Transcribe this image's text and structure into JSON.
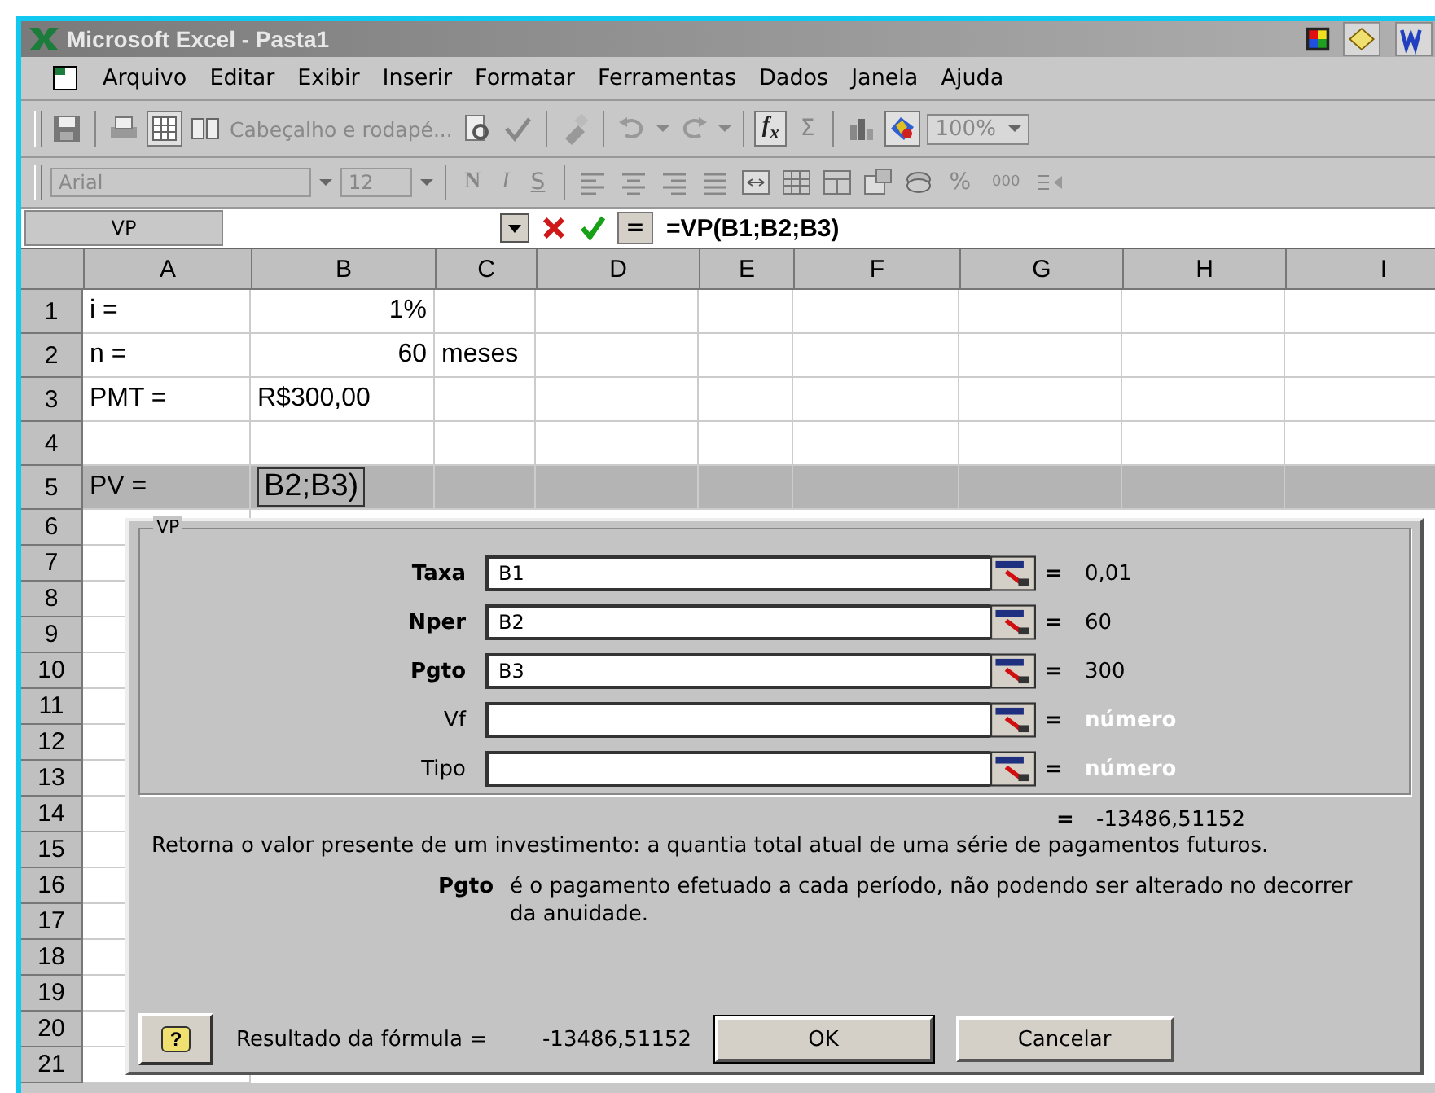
{
  "window": {
    "title": "Microsoft Excel - Pasta1"
  },
  "menu": [
    "Arquivo",
    "Editar",
    "Exibir",
    "Inserir",
    "Formatar",
    "Ferramentas",
    "Dados",
    "Janela",
    "Ajuda"
  ],
  "standard_toolbar": {
    "disabled": true,
    "header_footer": "Cabeçalho e rodapé...",
    "function": "f$_{x}$",
    "autosum": "Σ",
    "zoom": "100%"
  },
  "formatting_toolbar": {
    "disabled": true,
    "font": "Arial",
    "size": "12",
    "bold": "N",
    "italic": "I",
    "underline": "S",
    "percent": "%",
    "thousands": "000"
  },
  "formula_bar": {
    "name_box": "VP",
    "equals": "=",
    "formula": "=VP(B1;B2;B3)"
  },
  "sheet": {
    "columns": [
      "A",
      "B",
      "C",
      "D",
      "E",
      "F",
      "G",
      "H",
      "I"
    ],
    "rows": [
      {
        "header": "1",
        "highlighted": false,
        "cells": {
          "A": {
            "text": "i =",
            "kind": "text"
          },
          "B": {
            "text": "1%",
            "kind": "number"
          }
        }
      },
      {
        "header": "2",
        "highlighted": false,
        "cells": {
          "A": {
            "text": "n =",
            "kind": "text"
          },
          "B": {
            "text": "60",
            "kind": "number"
          },
          "C": {
            "text": "meses",
            "kind": "text"
          }
        }
      },
      {
        "header": "3",
        "highlighted": false,
        "cells": {
          "A": {
            "text": "PMT =",
            "kind": "text"
          },
          "B": {
            "text": "R$300,00",
            "kind": "text"
          }
        }
      },
      {
        "header": "4",
        "highlighted": false
      },
      {
        "header": "5",
        "highlighted": true,
        "cells": {
          "A": {
            "text": "PV =",
            "kind": "text"
          },
          "B": {
            "text": "B2;B3)",
            "kind": "editing"
          }
        }
      },
      {
        "header": "6",
        "highlighted": false
      },
      {
        "header": "7",
        "highlighted": false
      },
      {
        "header": "8",
        "highlighted": false
      },
      {
        "header": "9",
        "highlighted": false
      },
      {
        "header": "10",
        "highlighted": false
      },
      {
        "header": "11",
        "highlighted": false
      },
      {
        "header": "12",
        "highlighted": false
      },
      {
        "header": "13",
        "highlighted": false
      },
      {
        "header": "14",
        "highlighted": false
      },
      {
        "header": "15",
        "highlighted": false
      },
      {
        "header": "16",
        "highlighted": false
      },
      {
        "header": "17",
        "highlighted": false
      },
      {
        "header": "18",
        "highlighted": false
      },
      {
        "header": "19",
        "highlighted": false
      },
      {
        "header": "20",
        "highlighted": false
      },
      {
        "header": "21",
        "highlighted": false
      }
    ]
  },
  "dialog": {
    "group_title": "VP",
    "arguments": [
      {
        "label": "Taxa",
        "required": true,
        "value": "B1",
        "equals": "=",
        "result": "0,01"
      },
      {
        "label": "Nper",
        "required": true,
        "value": "B2",
        "equals": "=",
        "result": "60"
      },
      {
        "label": "Pgto",
        "required": true,
        "value": "B3",
        "equals": "=",
        "result": "300"
      },
      {
        "label": "Vf",
        "required": false,
        "equals": "=",
        "result": "número"
      },
      {
        "label": "Tipo",
        "required": false,
        "equals": "=",
        "result": "número"
      }
    ],
    "result": {
      "equals": "=",
      "value": "-13486,51152"
    },
    "description": "Retorna o valor presente de um investimento: a quantia total atual de uma série de pagamentos futuros.",
    "argument_help": {
      "name": "Pgto",
      "text": "é o pagamento efetuado a cada período, não podendo ser alterado no decorrer da anuidade."
    },
    "help": "?",
    "formula_result": {
      "label": "Resultado da fórmula =",
      "value": "-13486,51152"
    },
    "buttons": [
      {
        "label": "OK",
        "default": true
      },
      {
        "label": "Cancelar",
        "default": false
      }
    ]
  }
}
